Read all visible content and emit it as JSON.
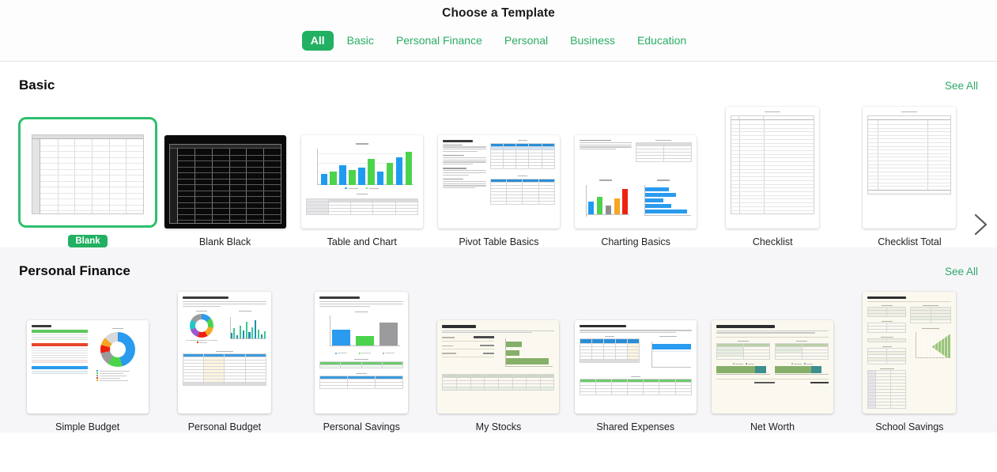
{
  "header": {
    "title": "Choose a Template",
    "tabs": [
      {
        "label": "All",
        "active": true
      },
      {
        "label": "Basic",
        "active": false
      },
      {
        "label": "Personal Finance",
        "active": false
      },
      {
        "label": "Personal",
        "active": false
      },
      {
        "label": "Business",
        "active": false
      },
      {
        "label": "Education",
        "active": false
      }
    ]
  },
  "colors": {
    "accent_green": "#22b062",
    "link_green": "#2fa86a",
    "selection_border": "#2fbf6e",
    "section_shade": "#f6f6f8",
    "page_bg": "#ffffff",
    "cream_paper": "#fbf9ef"
  },
  "sections": [
    {
      "title": "Basic",
      "see_all": "See All",
      "templates": [
        {
          "name": "Blank",
          "selected": true,
          "badge": "Blank",
          "orientation": "landscape",
          "art": "blank-sheet"
        },
        {
          "name": "Blank Black",
          "selected": false,
          "orientation": "landscape",
          "art": "blank-sheet-black"
        },
        {
          "name": "Table and Chart",
          "selected": false,
          "orientation": "landscape",
          "art": "table-and-chart"
        },
        {
          "name": "Pivot Table Basics",
          "selected": false,
          "orientation": "landscape",
          "art": "pivot-table-basics"
        },
        {
          "name": "Charting Basics",
          "selected": false,
          "orientation": "landscape",
          "art": "charting-basics"
        },
        {
          "name": "Checklist",
          "selected": false,
          "orientation": "portrait",
          "art": "checklist"
        },
        {
          "name": "Checklist Total",
          "selected": false,
          "orientation": "portrait",
          "art": "checklist-total"
        }
      ]
    },
    {
      "title": "Personal Finance",
      "see_all": "See All",
      "templates": [
        {
          "name": "Simple Budget",
          "selected": false,
          "orientation": "landscape",
          "art": "simple-budget"
        },
        {
          "name": "Personal Budget",
          "selected": false,
          "orientation": "portrait",
          "art": "personal-budget"
        },
        {
          "name": "Personal Savings",
          "selected": false,
          "orientation": "portrait",
          "art": "personal-savings"
        },
        {
          "name": "My Stocks",
          "selected": false,
          "orientation": "landscape",
          "art": "my-stocks"
        },
        {
          "name": "Shared Expenses",
          "selected": false,
          "orientation": "landscape",
          "art": "shared-expenses"
        },
        {
          "name": "Net Worth",
          "selected": false,
          "orientation": "landscape",
          "art": "net-worth"
        },
        {
          "name": "School Savings",
          "selected": false,
          "orientation": "portrait",
          "art": "school-savings"
        }
      ]
    }
  ],
  "nav": {
    "next_arrow": "chevron-right"
  },
  "thumbnail_text": {
    "pivot_title": "Pivot Table Basics",
    "simple_budget_title": "Budget",
    "personal_budget_title": "Monthly Budget",
    "personal_savings_title": "Monthly Goal",
    "my_stocks_title": "Portfolio",
    "shared_expenses_title": "Shared Expenses",
    "net_worth_title": "Net Worth Overview",
    "school_savings_title": "College Savings"
  }
}
